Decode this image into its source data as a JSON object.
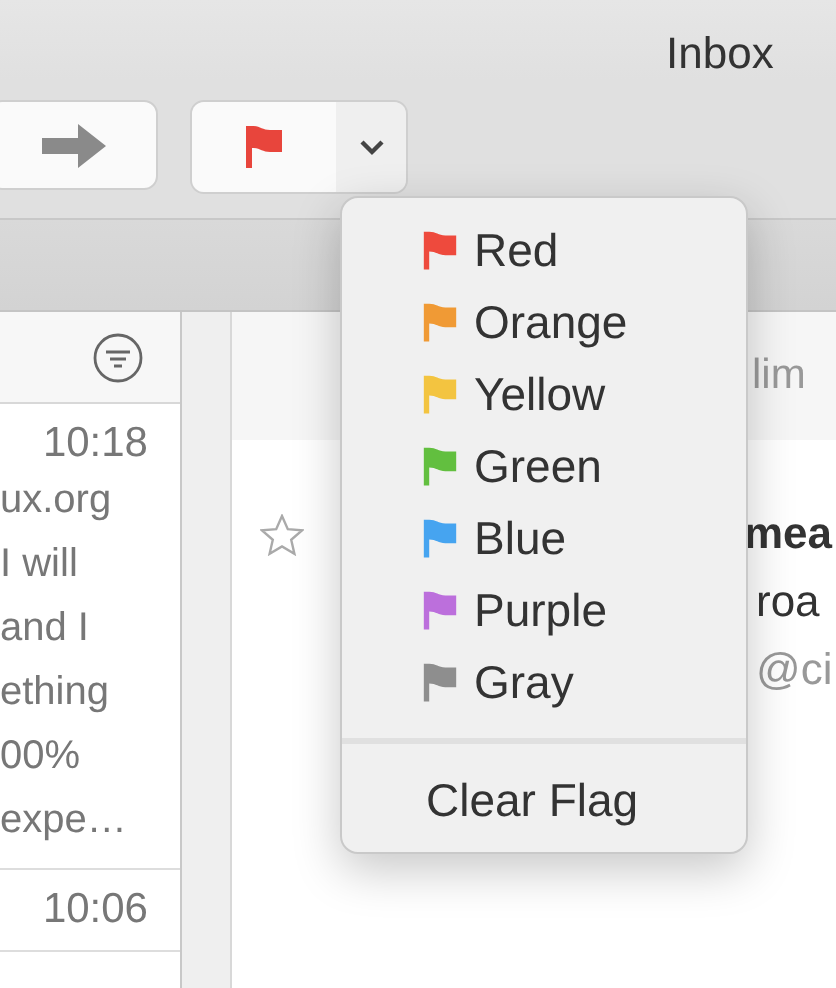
{
  "window": {
    "title": "Inbox"
  },
  "toolbar": {
    "flag_button": {
      "color": "#e8453c"
    }
  },
  "message_list": {
    "messages": [
      {
        "time": "10:18",
        "preview_lines": [
          "ux.org",
          "I will",
          "and I",
          "ething",
          "00%",
          "expe…"
        ]
      },
      {
        "time": "10:06"
      }
    ]
  },
  "message_view": {
    "header_text": "lim",
    "starred": false,
    "subject": "mea",
    "line_1": "roa",
    "line_2": "@ci"
  },
  "flag_menu": {
    "items": [
      {
        "label": "Red",
        "color": "#ee4a3d"
      },
      {
        "label": "Orange",
        "color": "#f09a35"
      },
      {
        "label": "Yellow",
        "color": "#f3c440"
      },
      {
        "label": "Green",
        "color": "#62bf3f"
      },
      {
        "label": "Blue",
        "color": "#46a4f0"
      },
      {
        "label": "Purple",
        "color": "#bc6fdc"
      },
      {
        "label": "Gray",
        "color": "#8e8e8e"
      }
    ],
    "clear_label": "Clear Flag"
  }
}
